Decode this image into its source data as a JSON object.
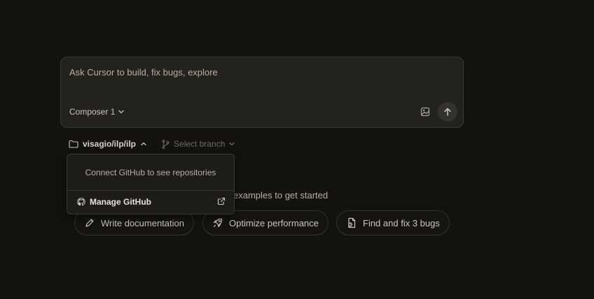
{
  "composer": {
    "placeholder": "Ask Cursor to build, fix bugs, explore",
    "model": "Composer 1"
  },
  "repo": {
    "name": "visagio/ilp/ilp",
    "branch_placeholder": "Select branch"
  },
  "dropdown": {
    "message": "Connect GitHub to see repositories",
    "manage_label": "Manage GitHub"
  },
  "examples": {
    "caption": "examples to get started",
    "chips": [
      {
        "label": "Write documentation",
        "icon": "pen-icon"
      },
      {
        "label": "Optimize performance",
        "icon": "rocket-icon"
      },
      {
        "label": "Find and fix 3 bugs",
        "icon": "bug-file-icon"
      }
    ]
  }
}
